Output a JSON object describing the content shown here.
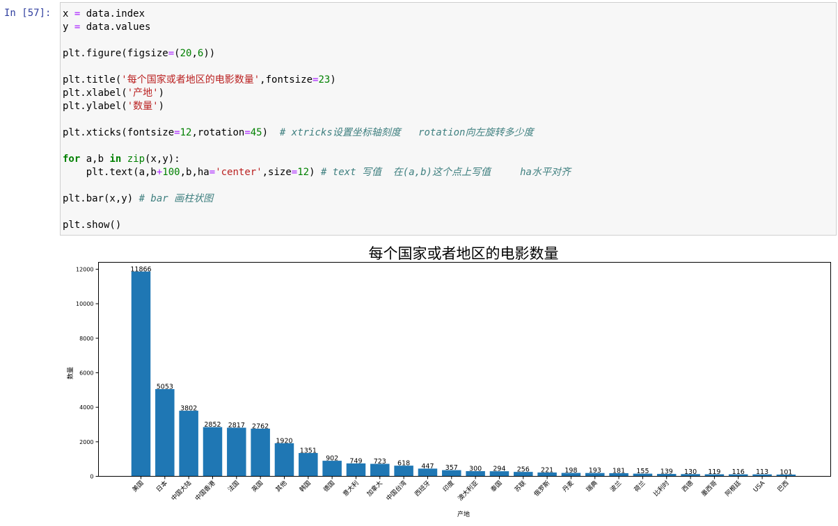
{
  "cell": {
    "prompt": "In [57]:",
    "code_lines": [
      [
        {
          "t": "x "
        },
        {
          "t": "=",
          "c": "op"
        },
        {
          "t": " data.index"
        }
      ],
      [
        {
          "t": "y "
        },
        {
          "t": "=",
          "c": "op"
        },
        {
          "t": " data.values"
        }
      ],
      [],
      [
        {
          "t": "plt.figure(figsize"
        },
        {
          "t": "=",
          "c": "op"
        },
        {
          "t": "("
        },
        {
          "t": "20",
          "c": "num"
        },
        {
          "t": ","
        },
        {
          "t": "6",
          "c": "num"
        },
        {
          "t": "))"
        }
      ],
      [],
      [
        {
          "t": "plt.title("
        },
        {
          "t": "'每个国家或者地区的电影数量'",
          "c": "str"
        },
        {
          "t": ",fontsize"
        },
        {
          "t": "=",
          "c": "op"
        },
        {
          "t": "23",
          "c": "num"
        },
        {
          "t": ")"
        }
      ],
      [
        {
          "t": "plt.xlabel("
        },
        {
          "t": "'产地'",
          "c": "str"
        },
        {
          "t": ")"
        }
      ],
      [
        {
          "t": "plt.ylabel("
        },
        {
          "t": "'数量'",
          "c": "str"
        },
        {
          "t": ")"
        }
      ],
      [],
      [
        {
          "t": "plt.xticks(fontsize"
        },
        {
          "t": "=",
          "c": "op"
        },
        {
          "t": "12",
          "c": "num"
        },
        {
          "t": ",rotation"
        },
        {
          "t": "=",
          "c": "op"
        },
        {
          "t": "45",
          "c": "num"
        },
        {
          "t": ")  "
        },
        {
          "t": "# xtricks设置坐标轴刻度   rotation向左旋转多少度",
          "c": "com"
        }
      ],
      [],
      [
        {
          "t": "for",
          "c": "kw"
        },
        {
          "t": " a,b "
        },
        {
          "t": "in",
          "c": "kw"
        },
        {
          "t": " "
        },
        {
          "t": "zip",
          "c": "bi"
        },
        {
          "t": "(x,y):"
        }
      ],
      [
        {
          "t": "    plt.text(a,b"
        },
        {
          "t": "+",
          "c": "op"
        },
        {
          "t": "100",
          "c": "num"
        },
        {
          "t": ",b,ha"
        },
        {
          "t": "=",
          "c": "op"
        },
        {
          "t": "'center'",
          "c": "str"
        },
        {
          "t": ",size"
        },
        {
          "t": "=",
          "c": "op"
        },
        {
          "t": "12",
          "c": "num"
        },
        {
          "t": ") "
        },
        {
          "t": "# text 写值  在(a,b)这个点上写值     ha水平对齐",
          "c": "com"
        }
      ],
      [],
      [
        {
          "t": "plt.bar(x,y) "
        },
        {
          "t": "# bar 画柱状图",
          "c": "com"
        }
      ],
      [],
      [
        {
          "t": "plt.show()"
        }
      ]
    ]
  },
  "chart_data": {
    "type": "bar",
    "title": "每个国家或者地区的电影数量",
    "xlabel": "产地",
    "ylabel": "数量",
    "ylim": [
      0,
      12400
    ],
    "yticks": [
      0,
      2000,
      4000,
      6000,
      8000,
      10000,
      12000
    ],
    "categories": [
      "美国",
      "日本",
      "中国大陆",
      "中国香港",
      "法国",
      "英国",
      "其他",
      "韩国",
      "德国",
      "意大利",
      "加拿大",
      "中国台湾",
      "西班牙",
      "印度",
      "澳大利亚",
      "泰国",
      "苏联",
      "俄罗斯",
      "丹麦",
      "瑞典",
      "波兰",
      "荷兰",
      "比利时",
      "西德",
      "墨西哥",
      "阿根廷",
      "USA",
      "巴西"
    ],
    "values": [
      11866,
      5053,
      3802,
      2852,
      2817,
      2762,
      1920,
      1351,
      902,
      749,
      723,
      618,
      447,
      357,
      300,
      294,
      256,
      221,
      198,
      193,
      181,
      155,
      139,
      130,
      119,
      116,
      113,
      101
    ],
    "bar_color": "#1f77b4",
    "grid": false
  }
}
